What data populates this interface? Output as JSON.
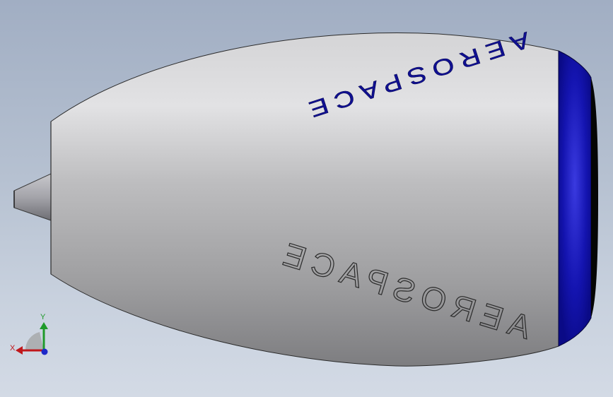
{
  "viewport": {
    "background_top": "#a1aec3",
    "background_bottom": "#d3dae5"
  },
  "model": {
    "name_text": "AEROSPACE",
    "body_color": "#b4b4b4",
    "band_color": "#0f0fa3",
    "rim_color": "#07075a",
    "lettering_color": "#101092",
    "spinner_color": "#9c9ca2"
  },
  "triad": {
    "x_label": "X",
    "y_label": "Y",
    "x_color": "#c0171b",
    "y_color": "#1f9a2a",
    "z_color": "#1d28c8"
  }
}
